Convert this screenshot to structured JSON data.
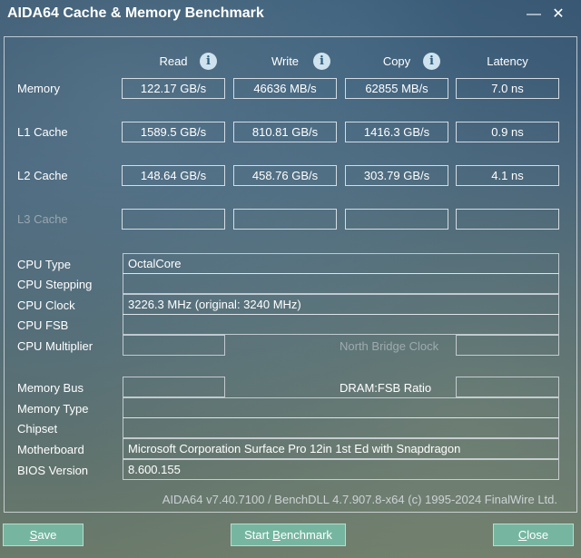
{
  "window": {
    "title": "AIDA64 Cache & Memory Benchmark"
  },
  "columns": {
    "read": "Read",
    "write": "Write",
    "copy": "Copy",
    "latency": "Latency"
  },
  "rows": [
    {
      "label": "Memory",
      "read": "122.17 GB/s",
      "write": "46636 MB/s",
      "copy": "62855 MB/s",
      "latency": "7.0 ns"
    },
    {
      "label": "L1 Cache",
      "read": "1589.5 GB/s",
      "write": "810.81 GB/s",
      "copy": "1416.3 GB/s",
      "latency": "0.9 ns"
    },
    {
      "label": "L2 Cache",
      "read": "148.64 GB/s",
      "write": "458.76 GB/s",
      "copy": "303.79 GB/s",
      "latency": "4.1 ns"
    },
    {
      "label": "L3 Cache",
      "read": "",
      "write": "",
      "copy": "",
      "latency": ""
    }
  ],
  "info": {
    "cpu_type_label": "CPU Type",
    "cpu_type": "OctalCore",
    "cpu_stepping_label": "CPU Stepping",
    "cpu_stepping": "",
    "cpu_clock_label": "CPU Clock",
    "cpu_clock": "3226.3 MHz  (original: 3240 MHz)",
    "cpu_fsb_label": "CPU FSB",
    "cpu_fsb": "",
    "cpu_multiplier_label": "CPU Multiplier",
    "cpu_multiplier": "",
    "north_bridge_clock_label": "North Bridge Clock",
    "north_bridge_clock": "",
    "memory_bus_label": "Memory Bus",
    "memory_bus": "",
    "dram_fsb_ratio_label": "DRAM:FSB Ratio",
    "dram_fsb_ratio": "",
    "memory_type_label": "Memory Type",
    "memory_type": "",
    "chipset_label": "Chipset",
    "chipset": "",
    "motherboard_label": "Motherboard",
    "motherboard": "Microsoft Corporation Surface Pro 12in 1st Ed with Snapdragon",
    "bios_label": "BIOS Version",
    "bios": "8.600.155"
  },
  "footer": {
    "version": "AIDA64 v7.40.7100 / BenchDLL 4.7.907.8-x64  (c) 1995-2024 FinalWire Ltd."
  },
  "buttons": {
    "save_pre": "",
    "save_key": "S",
    "save_post": "ave",
    "start_pre": "Start ",
    "start_key": "B",
    "start_post": "enchmark",
    "close_pre": "",
    "close_key": "C",
    "close_post": "lose"
  },
  "icons": {
    "minimize": "minimize-icon",
    "close": "close-icon",
    "info": "info-icon"
  },
  "colors": {
    "button": "#76b6a0",
    "info_icon": "#cfe3ee"
  }
}
